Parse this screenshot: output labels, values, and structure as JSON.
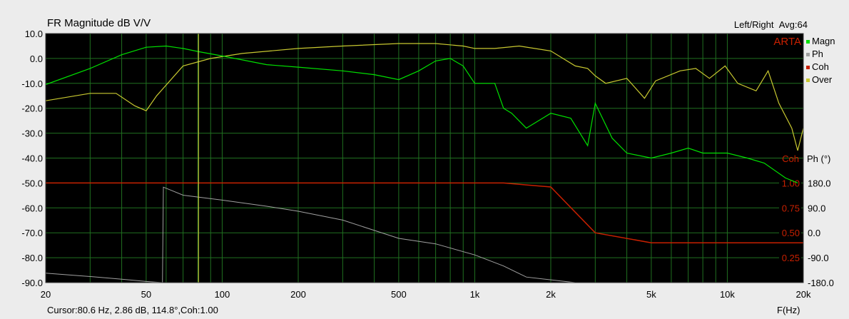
{
  "header": {
    "title": "FR Magnitude dB V/V",
    "mode": "Left/Right",
    "avg": "Avg:64",
    "brand": "ARTA"
  },
  "status": {
    "cursor": "Cursor:80.6 Hz, 2.86 dB, 114.8°,Coh:1.00",
    "xlabel": "F(Hz)"
  },
  "legend": [
    {
      "name": "Magn",
      "color": "#00e000"
    },
    {
      "name": "Ph",
      "color": "#a0a0a0"
    },
    {
      "name": "Coh",
      "color": "#c82000"
    },
    {
      "name": "Over",
      "color": "#c8c830"
    }
  ],
  "colors": {
    "background": "#000000",
    "grid": "#207020",
    "cursor": "#e0e040",
    "brand": "#c82000"
  },
  "chart_data": {
    "type": "line",
    "title": "FR Magnitude dB V/V",
    "xlabel": "F(Hz)",
    "xscale": "log",
    "xlim": [
      20,
      20000
    ],
    "ylim_left": [
      -90,
      10
    ],
    "ylabel_left": "dB",
    "x_tick_labels": [
      "20",
      "50",
      "100",
      "200",
      "500",
      "1k",
      "2k",
      "5k",
      "10k",
      "20k"
    ],
    "x_tick_values": [
      20,
      50,
      100,
      200,
      500,
      1000,
      2000,
      5000,
      10000,
      20000
    ],
    "y_tick_labels": [
      "10.0",
      "0.0",
      "-10.0",
      "-20.0",
      "-30.0",
      "-40.0",
      "-50.0",
      "-60.0",
      "-70.0",
      "-80.0",
      "-90.0"
    ],
    "y_tick_values": [
      10,
      0,
      -10,
      -20,
      -30,
      -40,
      -50,
      -60,
      -70,
      -80,
      -90
    ],
    "right_axis": {
      "coh_label": "Coh",
      "ph_label": "Ph (°)",
      "coh_ticks": [
        "1.00",
        "0.75",
        "0.50",
        "0.25"
      ],
      "ph_ticks": [
        "180.0",
        "90.0",
        "0.0",
        "-90.0",
        "-180.0"
      ],
      "ph_range": [
        -180,
        180
      ],
      "coh_range": [
        0,
        1
      ]
    },
    "cursor_hz": 80.6,
    "grid": true,
    "legend_position": "right",
    "series": [
      {
        "name": "Magn",
        "axis": "dB",
        "x": [
          20,
          30,
          40,
          50,
          60,
          70,
          80,
          100,
          150,
          200,
          300,
          400,
          500,
          600,
          700,
          800,
          900,
          1000,
          1200,
          1300,
          1400,
          1600,
          2000,
          2400,
          2800,
          3000,
          3500,
          4000,
          5000,
          6000,
          7000,
          8000,
          10000,
          12000,
          14000,
          17000,
          19000
        ],
        "y": [
          -10.5,
          -4,
          1.5,
          4.5,
          5,
          4,
          2.8,
          1,
          -2.5,
          -3.5,
          -5,
          -6.5,
          -8.5,
          -5,
          -1,
          0,
          -3,
          -10,
          -10,
          -20,
          -22,
          -28,
          -22,
          -24,
          -35,
          -18,
          -32,
          -38,
          -40,
          -38,
          -36,
          -38,
          -38,
          -40,
          -42,
          -48,
          -50
        ]
      },
      {
        "name": "Over",
        "axis": "dB",
        "x": [
          20,
          30,
          38,
          45,
          50,
          55,
          70,
          90,
          120,
          200,
          300,
          500,
          700,
          900,
          1000,
          1200,
          1500,
          2000,
          2500,
          2800,
          3000,
          3300,
          4000,
          4700,
          5200,
          6500,
          7500,
          8500,
          9800,
          11000,
          13000,
          14500,
          16000,
          18000,
          19000,
          20000
        ],
        "y": [
          -17,
          -14,
          -14,
          -19,
          -21,
          -15,
          -3,
          0,
          2,
          4,
          5,
          6,
          6,
          5,
          4,
          4,
          5,
          3,
          -3,
          -4,
          -7,
          -10,
          -8,
          -16,
          -9,
          -5,
          -4,
          -8,
          -3,
          -10,
          -13,
          -5,
          -18,
          -28,
          -37,
          -28
        ]
      },
      {
        "name": "Ph",
        "axis": "deg",
        "x": [
          20,
          30,
          40,
          50,
          58,
          58.5,
          70,
          100,
          150,
          200,
          300,
          500,
          700,
          1000,
          1300,
          1600,
          2000,
          2500,
          3000,
          4000,
          5000
        ],
        "y": [
          -146,
          -158,
          -168,
          -176,
          -180,
          165,
          136,
          118,
          96,
          78,
          46,
          -20,
          -40,
          -80,
          -120,
          -160,
          -170,
          -180,
          -180,
          -180,
          -180
        ]
      },
      {
        "name": "Coh",
        "axis": "coherence",
        "x": [
          20,
          1000,
          1300,
          2000,
          3000,
          5000,
          10000,
          20000
        ],
        "y": [
          1,
          1,
          1,
          0.96,
          0.5,
          0.4,
          0.4,
          0.4
        ]
      }
    ]
  }
}
